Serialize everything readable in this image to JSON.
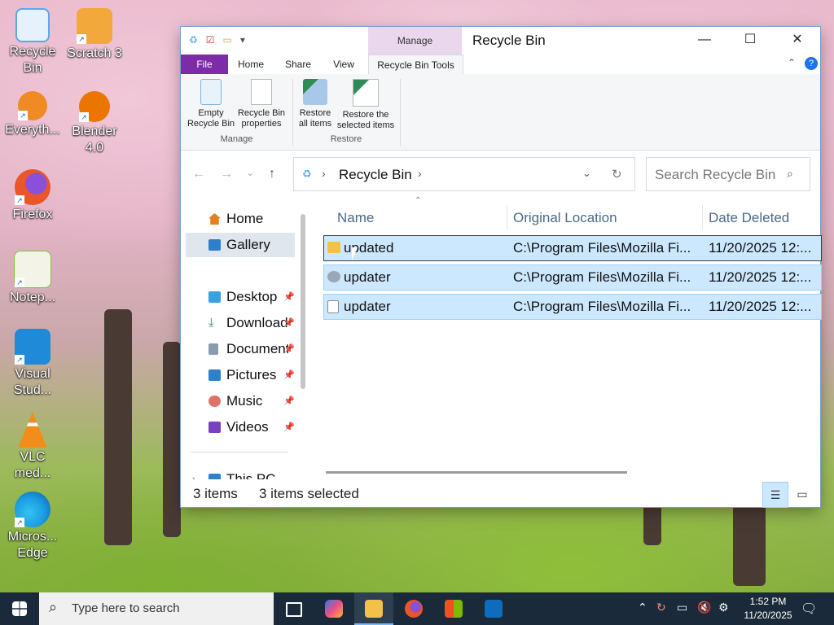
{
  "desktop": {
    "icons": [
      {
        "label": "Recycle Bin",
        "color": "#5aa9e6"
      },
      {
        "label": "Scratch 3",
        "color": "#f2a83b"
      },
      {
        "label": "Everyth...",
        "color": "#f08a24"
      },
      {
        "label": "Blender 4.0",
        "color": "#ea7600"
      },
      {
        "label": "Firefox",
        "color": "#e8562a"
      },
      {
        "label": "Notep...",
        "color": "#7cc242"
      },
      {
        "label": "Visual Stud...",
        "color": "#1f8ad8"
      },
      {
        "label": "VLC med...",
        "color": "#f28c1a"
      },
      {
        "label": "Micros... Edge",
        "color": "#1b9de2"
      }
    ]
  },
  "window": {
    "title": "Recycle Bin",
    "context_tab": "Manage",
    "tabs": {
      "file": "File",
      "home": "Home",
      "share": "Share",
      "view": "View",
      "tools": "Recycle Bin Tools"
    },
    "ribbon": {
      "empty": "Empty Recycle Bin",
      "properties": "Recycle Bin properties",
      "restore_all": "Restore all items",
      "restore_selected": "Restore the selected items",
      "group_manage": "Manage",
      "group_restore": "Restore"
    },
    "address": {
      "location": "Recycle Bin"
    },
    "search": {
      "placeholder": "Search Recycle Bin"
    },
    "nav": {
      "home": "Home",
      "gallery": "Gallery",
      "desktop": "Desktop",
      "downloads": "Downloads",
      "documents": "Documents",
      "pictures": "Pictures",
      "music": "Music",
      "videos": "Videos",
      "thispc": "This PC"
    },
    "columns": {
      "name": "Name",
      "location": "Original Location",
      "date": "Date Deleted"
    },
    "rows": [
      {
        "name": "updated",
        "location": "C:\\Program Files\\Mozilla Fi...",
        "date": "11/20/2025 12:..."
      },
      {
        "name": "updater",
        "location": "C:\\Program Files\\Mozilla Fi...",
        "date": "11/20/2025 12:..."
      },
      {
        "name": "updater",
        "location": "C:\\Program Files\\Mozilla Fi...",
        "date": "11/20/2025 12:..."
      }
    ],
    "status": {
      "count": "3 items",
      "selected": "3 items selected"
    }
  },
  "taskbar": {
    "search_placeholder": "Type here to search",
    "time": "1:52 PM",
    "date": "11/20/2025"
  }
}
